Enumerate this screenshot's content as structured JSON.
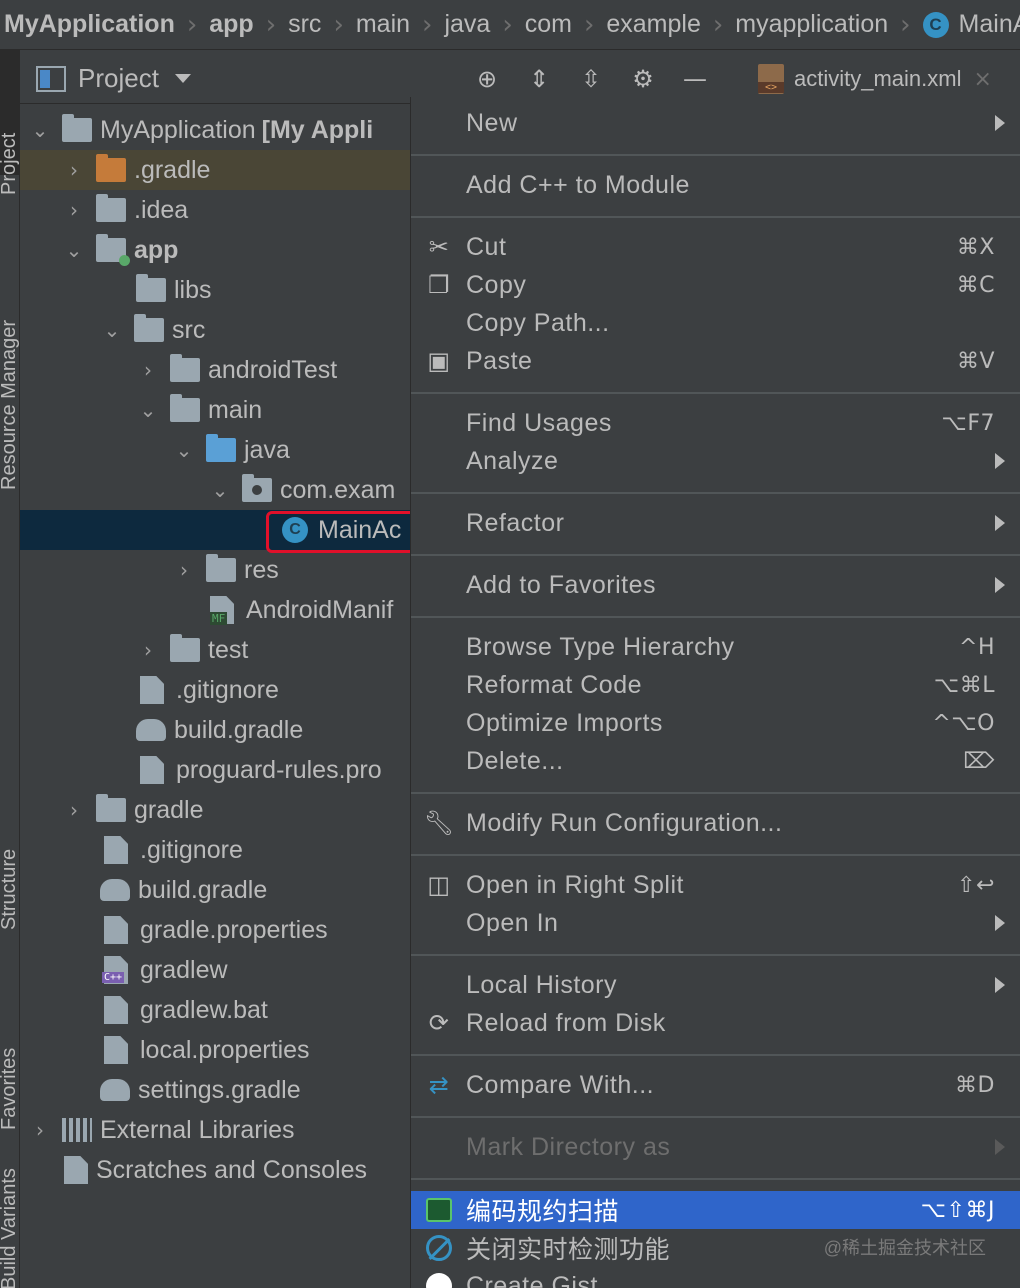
{
  "breadcrumb": [
    "MyApplication",
    "app",
    "src",
    "main",
    "java",
    "com",
    "example",
    "myapplication",
    "MainA"
  ],
  "breadcrumb_class_badge": "C",
  "stripe": {
    "project": "Project",
    "resource_manager": "Resource Manager",
    "structure": "Structure",
    "favorites": "Favorites",
    "build_variants": "Build Variants"
  },
  "header": {
    "title": "Project",
    "tab_label": "activity_main.xml",
    "tab_badge": "<>",
    "tab_close": "×"
  },
  "tree": {
    "root_name": "MyApplication",
    "root_module": "[My Appli",
    "gradle_dir": ".gradle",
    "idea_dir": ".idea",
    "app": "app",
    "libs": "libs",
    "src": "src",
    "android_test": "androidTest",
    "main": "main",
    "java": "java",
    "package": "com.exam",
    "main_activity": "MainAc",
    "class_badge": "C",
    "res": "res",
    "manifest": "AndroidManif",
    "manifest_badge": "MF",
    "test": "test",
    "app_gitignore": ".gitignore",
    "app_build_gradle": "build.gradle",
    "proguard": "proguard-rules.pro",
    "gradle": "gradle",
    "gitignore": ".gitignore",
    "build_gradle": "build.gradle",
    "gradle_properties": "gradle.properties",
    "gradlew": "gradlew",
    "gradlew_badge": "C++",
    "gradlew_bat": "gradlew.bat",
    "local_properties": "local.properties",
    "settings_gradle": "settings.gradle",
    "external_libraries": "External Libraries",
    "scratches": "Scratches and Consoles"
  },
  "menu": {
    "new": "New",
    "add_cpp": "Add C++ to Module",
    "cut": "Cut",
    "cut_sc": "⌘X",
    "copy": "Copy",
    "copy_sc": "⌘C",
    "copy_path": "Copy Path...",
    "paste": "Paste",
    "paste_sc": "⌘V",
    "find_usages": "Find Usages",
    "find_usages_sc": "⌥F7",
    "analyze": "Analyze",
    "refactor": "Refactor",
    "add_favorites": "Add to Favorites",
    "browse_hierarchy": "Browse Type Hierarchy",
    "browse_hierarchy_sc": "^H",
    "reformat": "Reformat Code",
    "reformat_sc": "⌥⌘L",
    "optimize": "Optimize Imports",
    "optimize_sc": "^⌥O",
    "delete": "Delete...",
    "delete_sc": "⌦",
    "modify_run": "Modify Run Configuration...",
    "open_right": "Open in Right Split",
    "open_right_sc": "⇧↩",
    "open_in": "Open In",
    "local_history": "Local History",
    "reload": "Reload from Disk",
    "compare": "Compare With...",
    "compare_sc": "⌘D",
    "mark_dir": "Mark Directory as",
    "scan": "编码规约扫描",
    "scan_sc": "⌥⇧⌘J",
    "close_realtime": "关闭实时检测功能",
    "create_gist": "Create Gist..."
  },
  "watermark": "@稀土掘金技术社区",
  "colors": {
    "background": "#3c3f41",
    "selection": "#2f65ca",
    "tree_selection": "#0d293e",
    "highlight_box": "#e0102a",
    "class_icon": "#3592c4"
  }
}
